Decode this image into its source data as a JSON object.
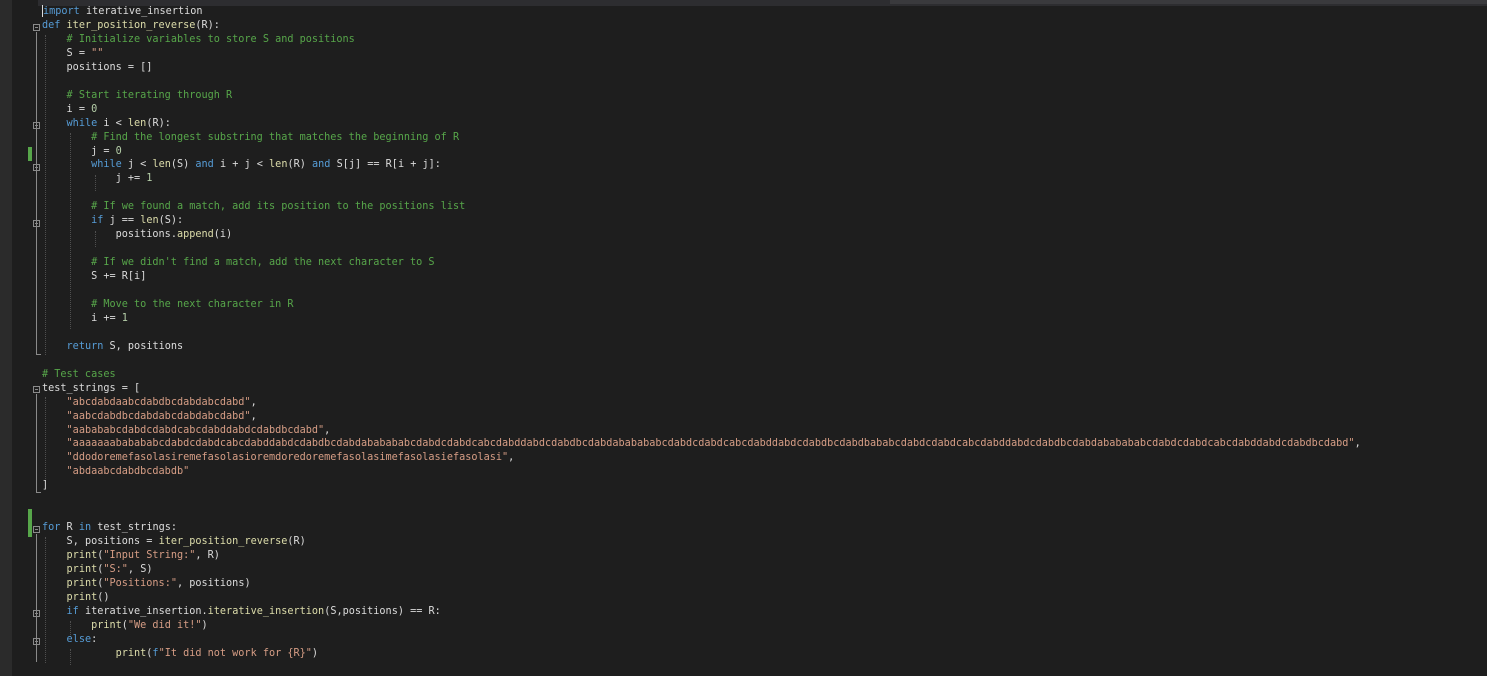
{
  "editor": {
    "language": "python",
    "colors": {
      "background": "#1e1e1e",
      "keyword": "#569cd6",
      "function": "#dcdcaa",
      "comment": "#57a64a",
      "string": "#d69d85",
      "identifier": "#dcdcdc",
      "change_marker": "#57a64a"
    },
    "lines": [
      "import iterative_insertion",
      "def iter_position_reverse(R):",
      "    # Initialize variables to store S and positions",
      "    S = \"\"",
      "    positions = []",
      "",
      "    # Start iterating through R",
      "    i = 0",
      "    while i < len(R):",
      "        # Find the longest substring that matches the beginning of R",
      "        j = 0",
      "        while j < len(S) and i + j < len(R) and S[j] == R[i + j]:",
      "            j += 1",
      "",
      "        # If we found a match, add its position to the positions list",
      "        if j == len(S):",
      "            positions.append(i)",
      "",
      "        # If we didn't find a match, add the next character to S",
      "        S += R[i]",
      "",
      "        # Move to the next character in R",
      "        i += 1",
      "",
      "    return S, positions",
      "",
      "# Test cases",
      "test_strings = [",
      "    \"abcdabdaabcdabdbcdabdabcdabd\",",
      "    \"aabcdabdbcdabdabcdabdabcdabd\",",
      "    \"aabababcdabdcdabdcabcdabddabdcdabdbcdabd\",",
      "    \"aaaaaaababababcdabdcdabdcabcdabddabdcdabdbcdabdababababcdabdcdabdcabcdabddabdcdabdbcdabdababababcdabdcdabdcabcdabddabdcdabdbcdabdbababcdabdcdabdcabcdabddabdcdabdbcdabdababababcdabdcdabdcabcdabddabdcdabdbcdabd\",",
      "    \"ddodoremefasolasiremefasolasioremdoredoremefasolasimefasolasiefasolasi\",",
      "    \"abdaabcdabdbcdabdb\"",
      "]",
      "",
      "",
      "for R in test_strings:",
      "    S, positions = iter_position_reverse(R)",
      "    print(\"Input String:\", R)",
      "    print(\"S:\", S)",
      "    print(\"Positions:\", positions)",
      "    print()",
      "    if iterative_insertion.iterative_insertion(S,positions) == R:",
      "        print(\"We did it!\")",
      "    else:",
      "            print(f\"It did not work for {R}\")"
    ]
  }
}
